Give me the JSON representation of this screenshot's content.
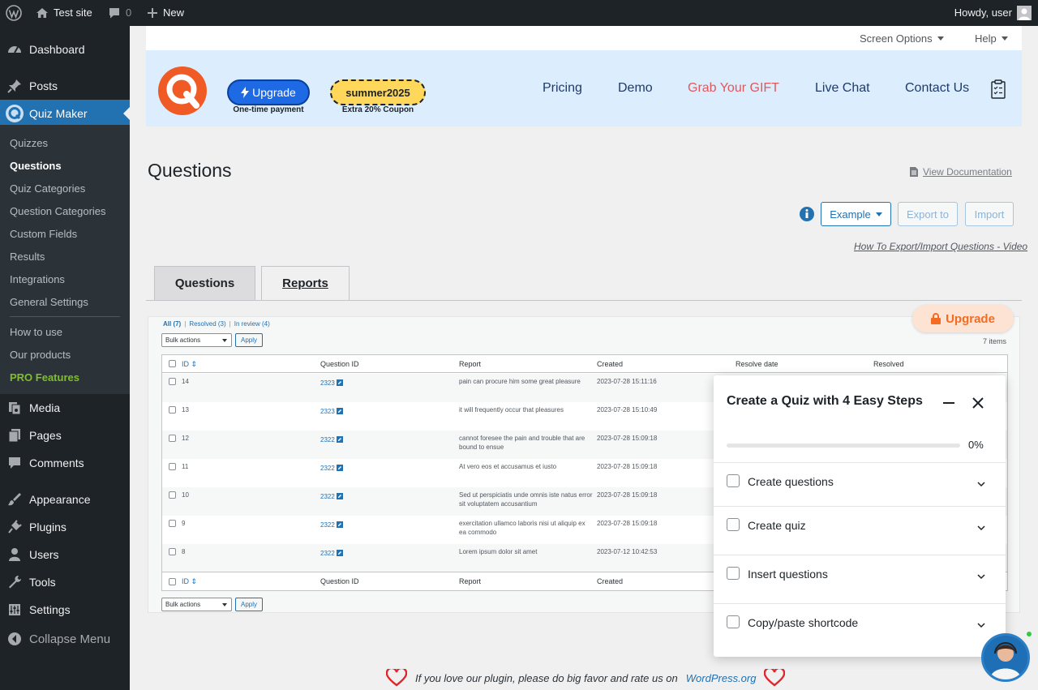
{
  "admin_bar": {
    "site_name": "Test site",
    "comments_count": "0",
    "new_label": "New",
    "howdy": "Howdy, user"
  },
  "sidebar": {
    "top_items": [
      {
        "label": "Dashboard",
        "icon": "dashboard-icon"
      },
      {
        "label": "Posts",
        "icon": "pin-icon"
      },
      {
        "label": "Quiz Maker",
        "icon": "quiz-maker-icon"
      }
    ],
    "sub_items": [
      "Quizzes",
      "Questions",
      "Quiz Categories",
      "Question Categories",
      "Custom Fields",
      "Results",
      "Integrations",
      "General Settings",
      "How to use",
      "Our products",
      "PRO Features"
    ],
    "bottom_items": [
      {
        "label": "Media",
        "icon": "media-icon"
      },
      {
        "label": "Pages",
        "icon": "pages-icon"
      },
      {
        "label": "Comments",
        "icon": "comments-icon"
      },
      {
        "label": "Appearance",
        "icon": "appearance-icon"
      },
      {
        "label": "Plugins",
        "icon": "plugins-icon"
      },
      {
        "label": "Users",
        "icon": "users-icon"
      },
      {
        "label": "Tools",
        "icon": "tools-icon"
      },
      {
        "label": "Settings",
        "icon": "settings-icon"
      },
      {
        "label": "Collapse Menu",
        "icon": "collapse-icon"
      }
    ]
  },
  "screen_meta": {
    "screen_options": "Screen Options",
    "help": "Help"
  },
  "banner": {
    "upgrade_label": "Upgrade",
    "upgrade_sub": "One-time payment",
    "coupon_code": "summer2025",
    "coupon_sub": "Extra 20% Coupon",
    "links": [
      "Pricing",
      "Demo",
      "Grab Your GIFT",
      "Live Chat",
      "Contact Us"
    ]
  },
  "page": {
    "title": "Questions",
    "view_docs": "View Documentation",
    "example_label": "Example",
    "export_label": "Export to",
    "import_label": "Import",
    "video_link": "How To Export/Import Questions - Video"
  },
  "tabs": [
    "Questions",
    "Reports"
  ],
  "reports": {
    "views": [
      "All (7)",
      "Resolved (3)",
      "In review (4)"
    ],
    "bulk_actions": "Bulk actions",
    "apply": "Apply",
    "items_count": "7 items",
    "columns": [
      "ID",
      "Question ID",
      "Report",
      "Created",
      "Resolve date",
      "Resolved"
    ],
    "rows": [
      {
        "id": "14",
        "question_id": "2323",
        "report": "pain can procure him some great pleasure",
        "created": "2023-07-28 15:11:16"
      },
      {
        "id": "13",
        "question_id": "2323",
        "report": "it will frequently occur that pleasures",
        "created": "2023-07-28 15:10:49"
      },
      {
        "id": "12",
        "question_id": "2322",
        "report": "cannot foresee the pain and trouble that are bound to ensue",
        "created": "2023-07-28 15:09:18"
      },
      {
        "id": "11",
        "question_id": "2322",
        "report": "At vero eos et accusamus et iusto",
        "created": "2023-07-28 15:09:18"
      },
      {
        "id": "10",
        "question_id": "2322",
        "report": "Sed ut perspiciatis unde omnis iste natus error sit voluptatem accusantium",
        "created": "2023-07-28 15:09:18"
      },
      {
        "id": "9",
        "question_id": "2322",
        "report": "exercitation ullamco laboris nisi ut aliquip ex ea commodo",
        "created": "2023-07-28 15:09:18"
      },
      {
        "id": "8",
        "question_id": "2322",
        "report": "Lorem ipsum dolor sit amet",
        "created": "2023-07-12 10:42:53"
      }
    ],
    "upgrade_label": "Upgrade"
  },
  "steps_panel": {
    "title": "Create a Quiz with 4 Easy Steps",
    "progress": "0%",
    "steps": [
      "Create questions",
      "Create quiz",
      "Insert questions",
      "Copy/paste shortcode"
    ]
  },
  "footer": {
    "text": "If you love our plugin, please do big favor and rate us on",
    "link": "WordPress.org"
  },
  "colors": {
    "admin_dark": "#1d2327",
    "wp_blue": "#2271b1",
    "banner_bg": "#dceefe",
    "upgrade_orange": "#f36c21",
    "gift_red": "#e0585b",
    "pro_green": "#7fbe2f"
  }
}
